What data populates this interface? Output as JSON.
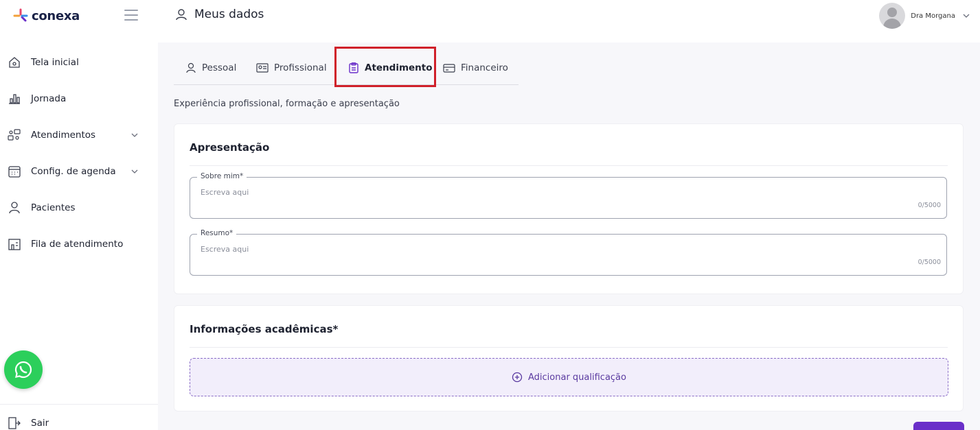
{
  "header": {
    "logo_text": "conexa",
    "page_title": "Meus dados",
    "user_name": "Dra Morgana"
  },
  "sidebar": {
    "items": [
      {
        "label": "Tela inicial",
        "icon": "home-icon"
      },
      {
        "label": "Jornada",
        "icon": "chart-icon"
      },
      {
        "label": "Atendimentos",
        "icon": "people-icon",
        "has_chevron": true
      },
      {
        "label": "Config. de agenda",
        "icon": "calendar-icon",
        "has_chevron": true
      },
      {
        "label": "Pacientes",
        "icon": "user-icon"
      },
      {
        "label": "Fila de atendimento",
        "icon": "queue-icon"
      }
    ],
    "logout_label": "Sair"
  },
  "tabs": [
    {
      "label": "Pessoal",
      "icon": "user-icon",
      "active": false
    },
    {
      "label": "Profissional",
      "icon": "id-card-icon",
      "active": false
    },
    {
      "label": "Atendimento",
      "icon": "clipboard-icon",
      "active": true
    },
    {
      "label": "Financeiro",
      "icon": "credit-card-icon",
      "active": false
    }
  ],
  "subtitle": "Experiência profissional, formação e apresentação",
  "presentation": {
    "title": "Apresentação",
    "fields": [
      {
        "label": "Sobre mim*",
        "placeholder": "Escreva aqui",
        "counter": "0/5000"
      },
      {
        "label": "Resumo*",
        "placeholder": "Escreva aqui",
        "counter": "0/5000"
      }
    ]
  },
  "academic": {
    "title": "Informações acadêmicas*",
    "add_label": "Adicionar qualificação"
  },
  "colors": {
    "accent": "#6a2fc9",
    "highlight": "#d0202a",
    "whatsapp": "#2ccf5b"
  }
}
